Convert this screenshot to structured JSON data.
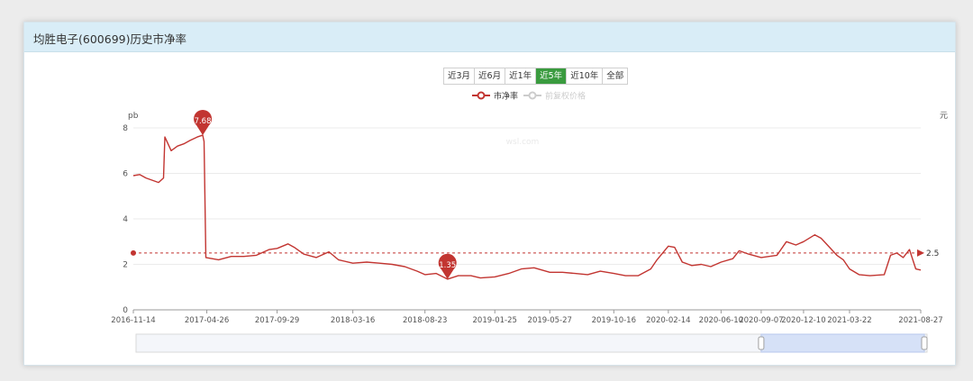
{
  "panel": {
    "title": "均胜电子(600699)历史市净率"
  },
  "range_buttons": [
    {
      "label": "近3月",
      "active": false
    },
    {
      "label": "近6月",
      "active": false
    },
    {
      "label": "近1年",
      "active": false
    },
    {
      "label": "近5年",
      "active": true
    },
    {
      "label": "近10年",
      "active": false
    },
    {
      "label": "全部",
      "active": false
    }
  ],
  "colors": {
    "series": "#c23531",
    "inactive": "#cccccc",
    "active_tab": "#3a9b3f",
    "zoom_window": "#d6e1f7"
  },
  "chart_data": {
    "type": "line",
    "title": "",
    "y_unit_left": "pb",
    "y_unit_right": "元",
    "ylim": [
      0,
      8
    ],
    "y_ticks": [
      "0",
      "2",
      "4",
      "6",
      "8"
    ],
    "x_tick_labels": [
      "2016-11-14",
      "2017-04-26",
      "2017-09-29",
      "2018-03-16",
      "2018-08-23",
      "2019-01-25",
      "2019-05-27",
      "2019-10-16",
      "2020-02-14",
      "2020-06-10",
      "2020-09-07",
      "2020-12-10",
      "2021-03-22",
      "2021-08-27"
    ],
    "legend": [
      {
        "name": "市净率",
        "active": true
      },
      {
        "name": "前复权价格",
        "active": false
      }
    ],
    "legend_placement": "top-center",
    "grid": true,
    "watermark": "wsl.com",
    "series": [
      {
        "name": "市净率",
        "points": [
          [
            "2016-11-14",
            5.9
          ],
          [
            "2016-11-28",
            5.95
          ],
          [
            "2016-12-12",
            5.8
          ],
          [
            "2016-12-26",
            5.7
          ],
          [
            "2017-01-09",
            5.6
          ],
          [
            "2017-01-20",
            5.8
          ],
          [
            "2017-01-23",
            7.6
          ],
          [
            "2017-02-06",
            7.0
          ],
          [
            "2017-02-20",
            7.2
          ],
          [
            "2017-03-06",
            7.3
          ],
          [
            "2017-03-20",
            7.45
          ],
          [
            "2017-04-05",
            7.6
          ],
          [
            "2017-04-17",
            7.68
          ],
          [
            "2017-04-20",
            7.4
          ],
          [
            "2017-04-24",
            2.3
          ],
          [
            "2017-05-22",
            2.2
          ],
          [
            "2017-06-19",
            2.35
          ],
          [
            "2017-07-17",
            2.35
          ],
          [
            "2017-08-14",
            2.4
          ],
          [
            "2017-09-11",
            2.65
          ],
          [
            "2017-09-29",
            2.7
          ],
          [
            "2017-10-23",
            2.9
          ],
          [
            "2017-11-06",
            2.75
          ],
          [
            "2017-11-27",
            2.45
          ],
          [
            "2017-12-25",
            2.3
          ],
          [
            "2018-01-22",
            2.55
          ],
          [
            "2018-02-12",
            2.2
          ],
          [
            "2018-03-16",
            2.05
          ],
          [
            "2018-04-16",
            2.1
          ],
          [
            "2018-05-14",
            2.05
          ],
          [
            "2018-06-11",
            2.0
          ],
          [
            "2018-07-09",
            1.9
          ],
          [
            "2018-08-06",
            1.7
          ],
          [
            "2018-08-23",
            1.55
          ],
          [
            "2018-09-17",
            1.6
          ],
          [
            "2018-10-12",
            1.35
          ],
          [
            "2018-11-05",
            1.5
          ],
          [
            "2018-12-03",
            1.5
          ],
          [
            "2018-12-24",
            1.4
          ],
          [
            "2019-01-25",
            1.45
          ],
          [
            "2019-02-25",
            1.6
          ],
          [
            "2019-03-25",
            1.8
          ],
          [
            "2019-04-22",
            1.85
          ],
          [
            "2019-05-27",
            1.65
          ],
          [
            "2019-06-24",
            1.65
          ],
          [
            "2019-07-22",
            1.6
          ],
          [
            "2019-08-19",
            1.55
          ],
          [
            "2019-09-16",
            1.7
          ],
          [
            "2019-10-16",
            1.6
          ],
          [
            "2019-11-11",
            1.5
          ],
          [
            "2019-12-09",
            1.5
          ],
          [
            "2020-01-06",
            1.8
          ],
          [
            "2020-01-20",
            2.2
          ],
          [
            "2020-02-14",
            2.8
          ],
          [
            "2020-02-28",
            2.75
          ],
          [
            "2020-03-16",
            2.1
          ],
          [
            "2020-04-06",
            1.95
          ],
          [
            "2020-04-27",
            2.0
          ],
          [
            "2020-05-18",
            1.9
          ],
          [
            "2020-06-10",
            2.1
          ],
          [
            "2020-07-06",
            2.25
          ],
          [
            "2020-07-20",
            2.6
          ],
          [
            "2020-08-10",
            2.45
          ],
          [
            "2020-09-07",
            2.3
          ],
          [
            "2020-10-12",
            2.4
          ],
          [
            "2020-11-02",
            3.0
          ],
          [
            "2020-11-23",
            2.85
          ],
          [
            "2020-12-10",
            3.0
          ],
          [
            "2021-01-04",
            3.3
          ],
          [
            "2021-01-18",
            3.15
          ],
          [
            "2021-02-01",
            2.85
          ],
          [
            "2021-02-22",
            2.4
          ],
          [
            "2021-03-08",
            2.2
          ],
          [
            "2021-03-22",
            1.8
          ],
          [
            "2021-04-12",
            1.55
          ],
          [
            "2021-05-06",
            1.5
          ],
          [
            "2021-06-07",
            1.55
          ],
          [
            "2021-06-21",
            2.4
          ],
          [
            "2021-07-05",
            2.5
          ],
          [
            "2021-07-19",
            2.3
          ],
          [
            "2021-08-02",
            2.65
          ],
          [
            "2021-08-16",
            1.8
          ],
          [
            "2021-08-27",
            1.75
          ]
        ]
      }
    ],
    "markers": [
      {
        "label": "7.68",
        "x": "2017-04-17",
        "y": 7.68,
        "type": "max"
      },
      {
        "label": "1.35",
        "x": "2018-10-12",
        "y": 1.35,
        "type": "min"
      }
    ],
    "average_line": {
      "value": 2.5,
      "label": "2.5"
    },
    "datazoom_window": [
      "2020-09-07",
      "2021-08-27"
    ]
  }
}
